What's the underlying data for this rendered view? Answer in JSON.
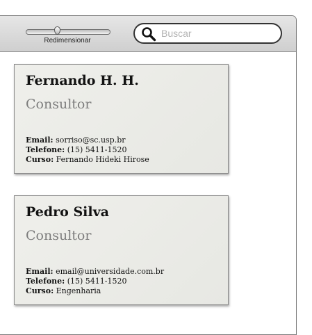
{
  "toolbar": {
    "resize_label": "Redimensionar",
    "resize_level": 0.38,
    "search": {
      "placeholder": "Buscar",
      "value": ""
    }
  },
  "cards": [
    {
      "name": "Fernando H. H.",
      "role": "Consultor",
      "email_label": "Email:",
      "email": "sorriso@sc.usp.br",
      "phone_label": "Telefone:",
      "phone": "(15) 5411-1520",
      "course_label": "Curso:",
      "course": "Fernando Hideki Hirose"
    },
    {
      "name": "Pedro Silva",
      "role": "Consultor",
      "email_label": "Email:",
      "email": "email@universidade.com.br",
      "phone_label": "Telefone:",
      "phone": "(15) 5411-1520",
      "course_label": "Curso:",
      "course": "Engenharia"
    }
  ],
  "colors": {
    "card_background": "#ecede8",
    "role_text": "#7d7d7d",
    "toolbar_background": "#d9d9d9"
  },
  "icons": [
    "search-icon",
    "slider-thumb"
  ]
}
